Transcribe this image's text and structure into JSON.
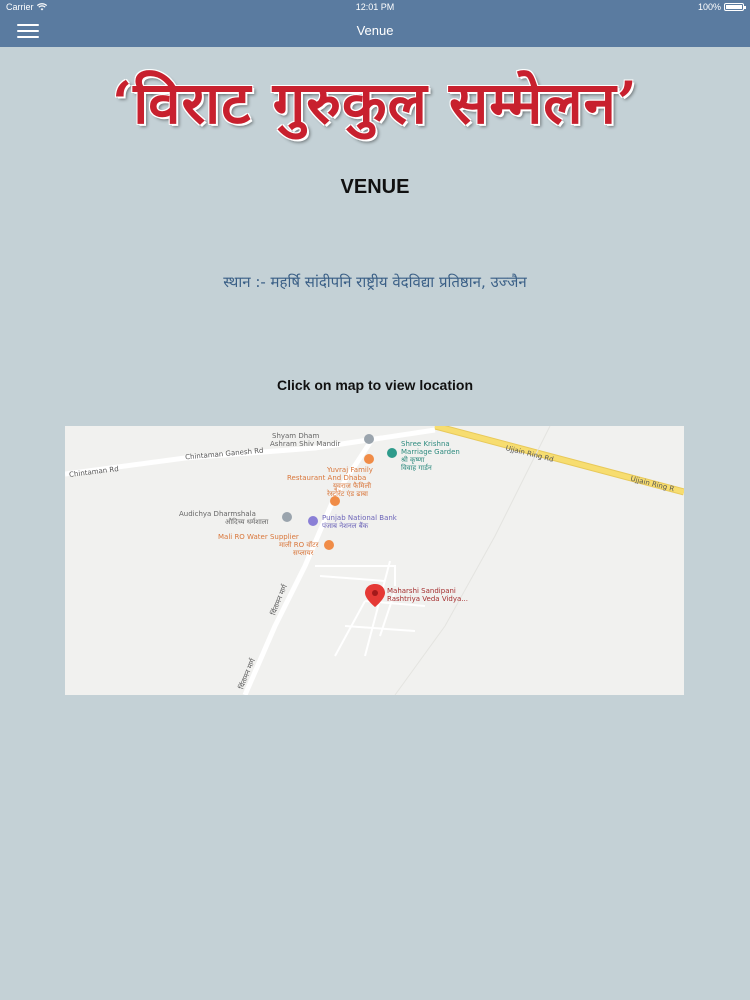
{
  "status_bar": {
    "carrier": "Carrier",
    "time": "12:01 PM",
    "battery": "100%"
  },
  "nav": {
    "title": "Venue"
  },
  "banner": {
    "text": "‘विराट गुरुकुल सम्मेलन’"
  },
  "page": {
    "title": "VENUE",
    "venue": "स्थान :- महर्षि सांदीपनि राष्ट्रीय वेदविद्या प्रतिष्ठान, उज्जैन",
    "map_hint": "Click on map to view location"
  },
  "map": {
    "labels": {
      "shyam_dham_1": "Shyam Dham",
      "shyam_dham_2": "Ashram Shiv Mandir",
      "shree_krishna_1": "Shree Krishna",
      "shree_krishna_2": "Marriage Garden",
      "shree_krishna_3": "श्री कृष्णा",
      "shree_krishna_4": "विवाह गार्डन",
      "ujjain_ring_1": "Ujjain Ring Rd",
      "ujjain_ring_2": "Ujjain Ring R",
      "yuvraj_1": "Yuvraj Family",
      "yuvraj_2": "Restaurant And Dhaba",
      "yuvraj_3": "युवराज फैमिली",
      "yuvraj_4": "रेस्टोरेंट एंड ढाबा",
      "audichya_1": "Audichya Dharmshala",
      "audichya_2": "औदिच्य धर्मशाला",
      "pnb_1": "Punjab National Bank",
      "pnb_2": "पंजाब नेशनल बैंक",
      "mali_1": "Mali RO Water Supplier",
      "mali_2": "माली RO वॉटर",
      "mali_3": "सप्लायर",
      "maharshi_1": "Maharshi Sandipani",
      "maharshi_2": "Rashtriya Veda Vidya...",
      "road_left": "Chintaman Rd",
      "road_top": "Chintaman Ganesh Rd",
      "road_vert_1": "चिंतामन मार्ग",
      "road_vert_2": "चिंतामन मार्ग"
    },
    "colors": {
      "background": "#f1f1ef",
      "road": "#ffffff",
      "highway": "#f7dd70",
      "pin": "#e53935"
    }
  }
}
